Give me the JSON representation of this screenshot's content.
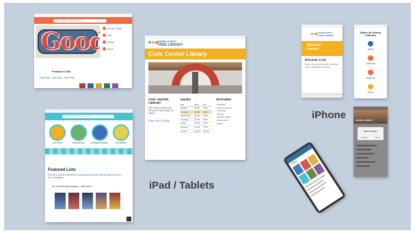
{
  "slide": {
    "ipad_label": "iPad / Tablets",
    "iphone_label": "iPhone"
  },
  "colors": {
    "background": "#c5d0de",
    "brand_orange": "#f06b3f",
    "brand_yellow": "#f3b120",
    "brand_teal": "#45c3d3",
    "brand_blue": "#2b6ea8"
  },
  "tablet1": {
    "search_text": "Find a book, movie, or event",
    "menu_items": [
      "Borrow Things",
      "Visit",
      "Events",
      "About"
    ],
    "featured_title": "Featured Lists",
    "lists_link": "Staff Picks  ·  Kids Picks  ·  Teen Picks"
  },
  "tablet2": {
    "brand_line1": "MARIN COUNTY",
    "brand_line2": "FREE LIBRARY",
    "page_title": "Civic Center Library",
    "section_civic": "CIVIC CENTER LIBRARY",
    "address": "3501 Civic Center Drive, Room 427 San Rafael CA 94903",
    "phone_line": "Phone: 415-473-6058",
    "section_hours": "HOURS",
    "section_features": "FEATURES",
    "hours_head": [
      "Day",
      "Open",
      "Cls"
    ],
    "hours": [
      [
        "Monday",
        "10 AM",
        "6 PM"
      ],
      [
        "Tuesday",
        "10 AM",
        "8 PM"
      ],
      [
        "Wednesday",
        "10 AM",
        "8 PM"
      ],
      [
        "Thursday",
        "10 AM",
        "8 PM"
      ],
      [
        "Friday",
        "10 AM",
        "6 PM"
      ],
      [
        "Saturday",
        "10 AM",
        "5 PM"
      ],
      [
        "Sunday",
        "Closed",
        "Closed"
      ]
    ],
    "features": [
      "Handicap",
      "Public computers",
      "Free Wi-Fi",
      "Printing",
      "Meeting spaces",
      "Study rooms",
      "Notary"
    ]
  },
  "tablet3": {
    "search_text": "Find a book, movie, or event",
    "tiles": [
      "STORYTIME",
      "MAKERSPACE",
      "SUMMER LEARNING",
      "PROGRAMS"
    ],
    "featured_title": "Featured Lists",
    "featured_desc": "Our list is a playful selection of books and movies for kids and adults chosen by our librarians.",
    "list_title": "Do Ya Prefer Big Questions... Wha Now?"
  },
  "phone1": {
    "brand_line1": "MARIN COUNTY",
    "brand_line2": "FREE LIBRARY",
    "hero": "Museum Passes",
    "section": "Discover & Go",
    "body": "Explore free admission with your library card to participating museums."
  },
  "phone2": {
    "title": "Explore the eLibrary Collection",
    "items": [
      "eBooks",
      "Audiobooks",
      "Magazines",
      "Movies"
    ]
  },
  "phone3": {
    "header": "ONLINE LIBRARY",
    "dialog_title": "Open in App?",
    "dialog_cancel": "Cancel",
    "dialog_ok": "Open"
  },
  "tilted_phone": {
    "title": "Catalog"
  }
}
